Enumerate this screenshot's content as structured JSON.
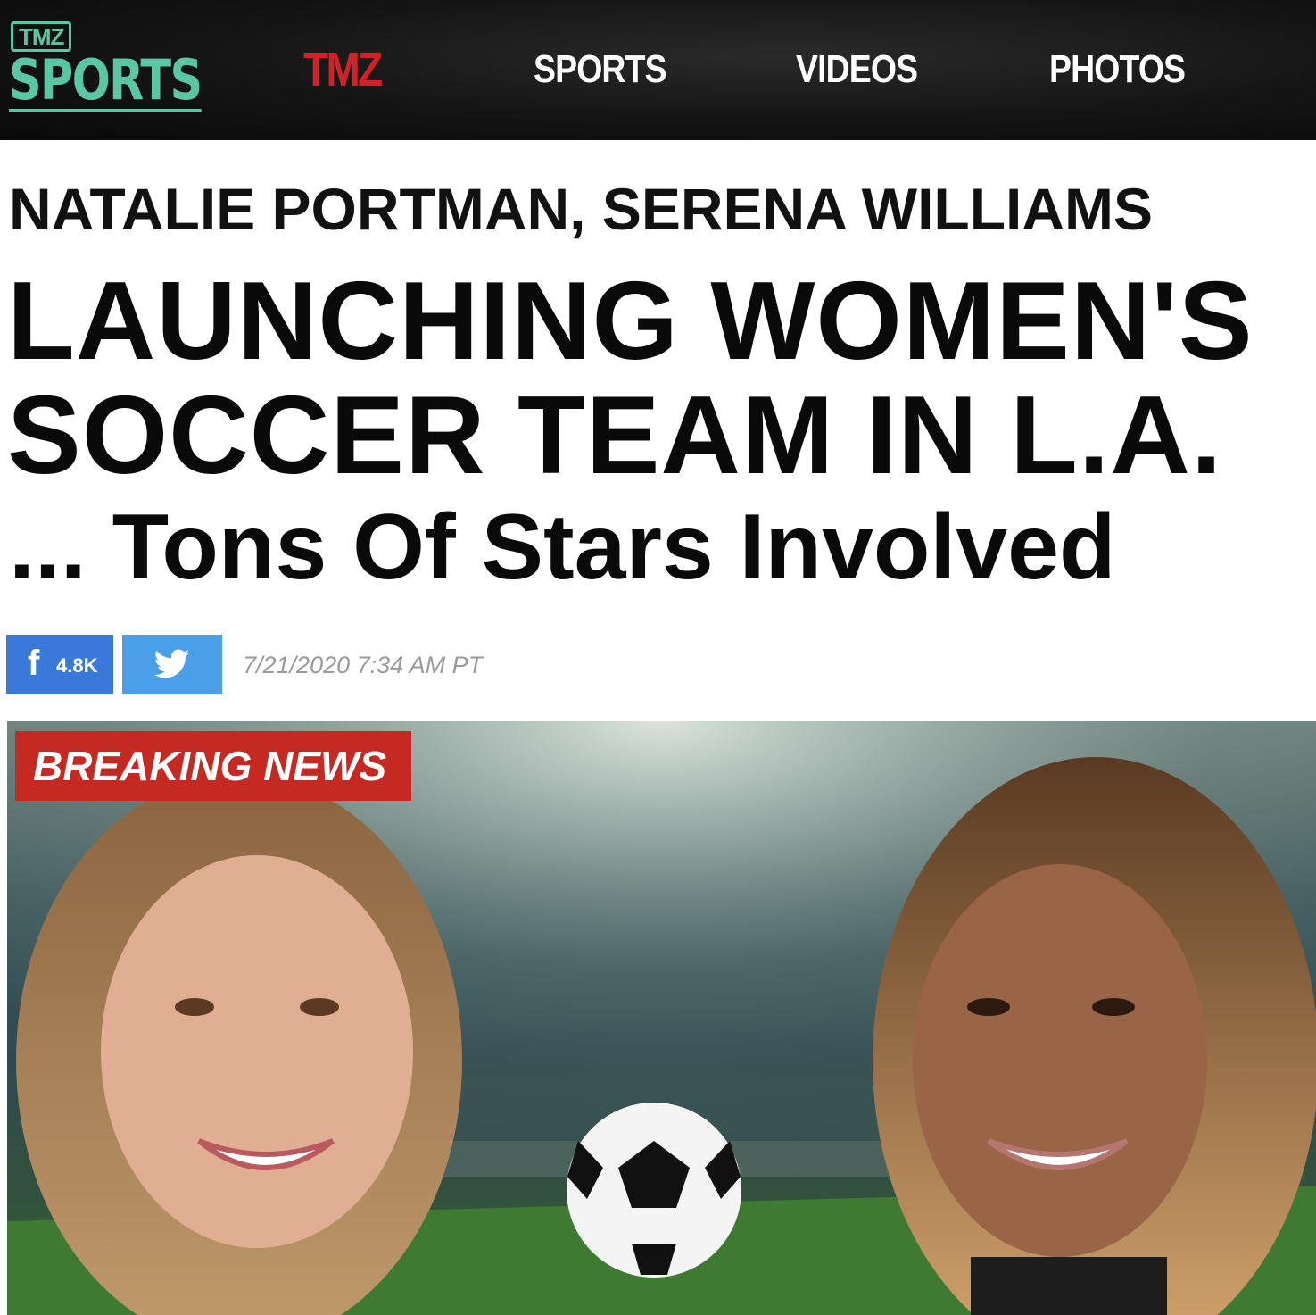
{
  "header": {
    "logo": {
      "top_text": "TMZ",
      "main_text": "SPORTS",
      "color": "#59c7a3"
    },
    "nav": [
      {
        "label": "TMZ",
        "color": "#d42027"
      },
      {
        "label": "SPORTS"
      },
      {
        "label": "VIDEOS"
      },
      {
        "label": "PHOTOS"
      }
    ]
  },
  "article": {
    "kicker": "NATALIE PORTMAN, SERENA WILLIAMS",
    "headline": "LAUNCHING WOMEN'S SOCCER TEAM IN L.A.",
    "subhead": "... Tons Of Stars Involved",
    "share": {
      "facebook": {
        "icon": "f",
        "count": "4.8K",
        "color": "#3b79d8"
      },
      "twitter": {
        "icon": "twitter-bird",
        "color": "#4a9fe8"
      }
    },
    "timestamp": "7/21/2020 7:34 AM PT"
  },
  "hero": {
    "badge": "BREAKING NEWS",
    "badge_color": "#c42a22"
  }
}
